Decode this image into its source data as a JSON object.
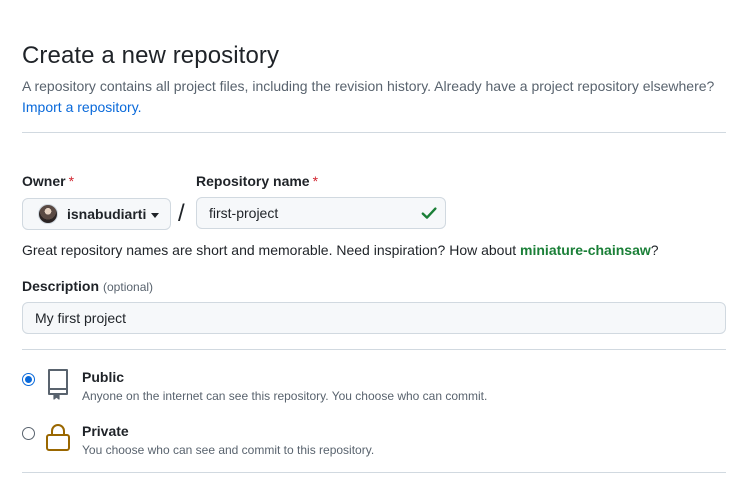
{
  "page": {
    "title": "Create a new repository",
    "subtitle_text": "A repository contains all project files, including the revision history. Already have a project repository elsewhere?",
    "import_link": "Import a repository."
  },
  "owner": {
    "label": "Owner",
    "required_mark": "*",
    "selected": "isnabudiarti"
  },
  "repo": {
    "label": "Repository name",
    "required_mark": "*",
    "value": "first-project",
    "slash": "/",
    "hint_prefix": "Great repository names are short and memorable. Need inspiration? How about",
    "suggestion": "miniature-chainsaw",
    "hint_suffix": "?"
  },
  "description": {
    "label": "Description",
    "optional": "(optional)",
    "value": "My first project"
  },
  "visibility": {
    "public": {
      "title": "Public",
      "desc": "Anyone on the internet can see this repository. You choose who can commit.",
      "selected": true,
      "icon": "repo-icon"
    },
    "private": {
      "title": "Private",
      "desc": "You choose who can see and commit to this repository.",
      "selected": false,
      "icon": "lock-icon"
    }
  },
  "colors": {
    "link": "#0969da",
    "success": "#1a7f37",
    "required": "#d1242f",
    "lock": "#9a6700"
  }
}
